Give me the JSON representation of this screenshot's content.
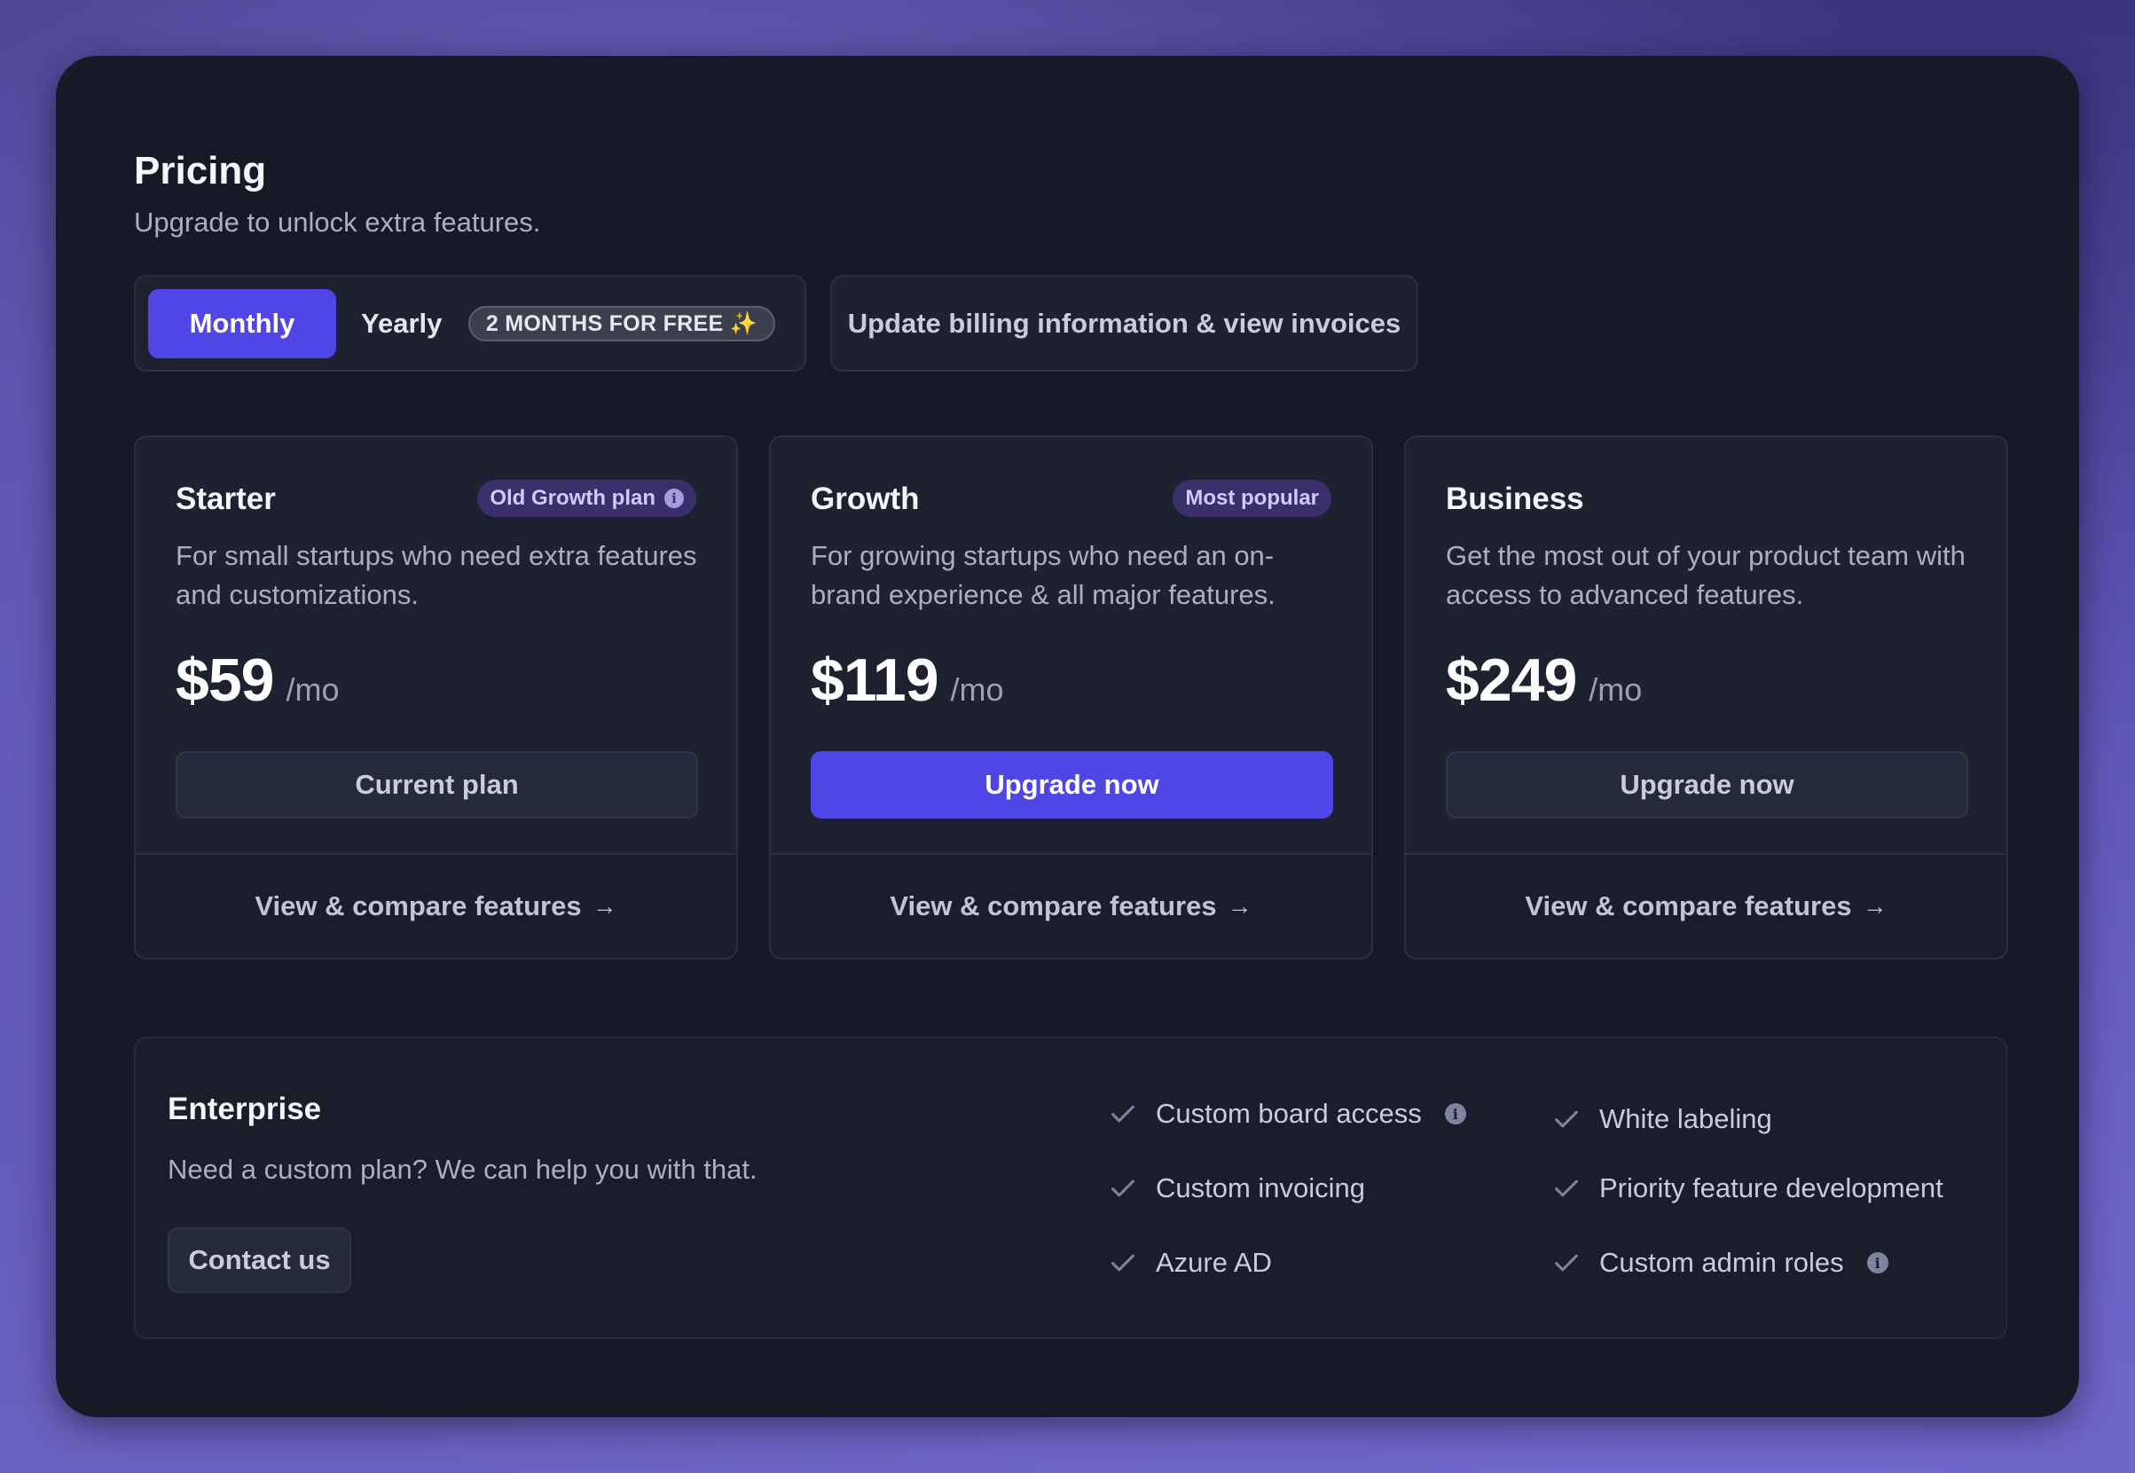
{
  "header": {
    "title": "Pricing",
    "subtitle": "Upgrade to unlock extra features."
  },
  "billing_toggle": {
    "monthly_label": "Monthly",
    "yearly_label": "Yearly",
    "promo_badge": "2 MONTHS FOR FREE ✨",
    "selected": "Monthly"
  },
  "billing_link": "Update billing information & view invoices",
  "plans": [
    {
      "name": "Starter",
      "badge": "Old Growth plan",
      "description": "For small startups who need extra features and customizations.",
      "price": "$59",
      "period": "/mo",
      "button": "Current plan",
      "compare": "View & compare features"
    },
    {
      "name": "Growth",
      "badge": "Most popular",
      "description": "For growing startups who need an on-brand experience & all major features.",
      "price": "$119",
      "period": "/mo",
      "button": "Upgrade now",
      "compare": "View & compare features"
    },
    {
      "name": "Business",
      "description": "Get the most out of your product team with access to advanced features.",
      "price": "$249",
      "period": "/mo",
      "button": "Upgrade now",
      "compare": "View & compare features"
    }
  ],
  "enterprise": {
    "title": "Enterprise",
    "description": "Need a custom plan? We can help you with that.",
    "button": "Contact us",
    "features": [
      "Custom board access",
      "Custom invoicing",
      "Azure AD",
      "White labeling",
      "Priority feature development",
      "Custom admin roles"
    ]
  },
  "colors": {
    "accent": "#4f46e5",
    "panel": "#171a26",
    "card": "#1d2130",
    "badge_bg": "#3a2f6a",
    "badge_text": "#d4c8ff"
  }
}
